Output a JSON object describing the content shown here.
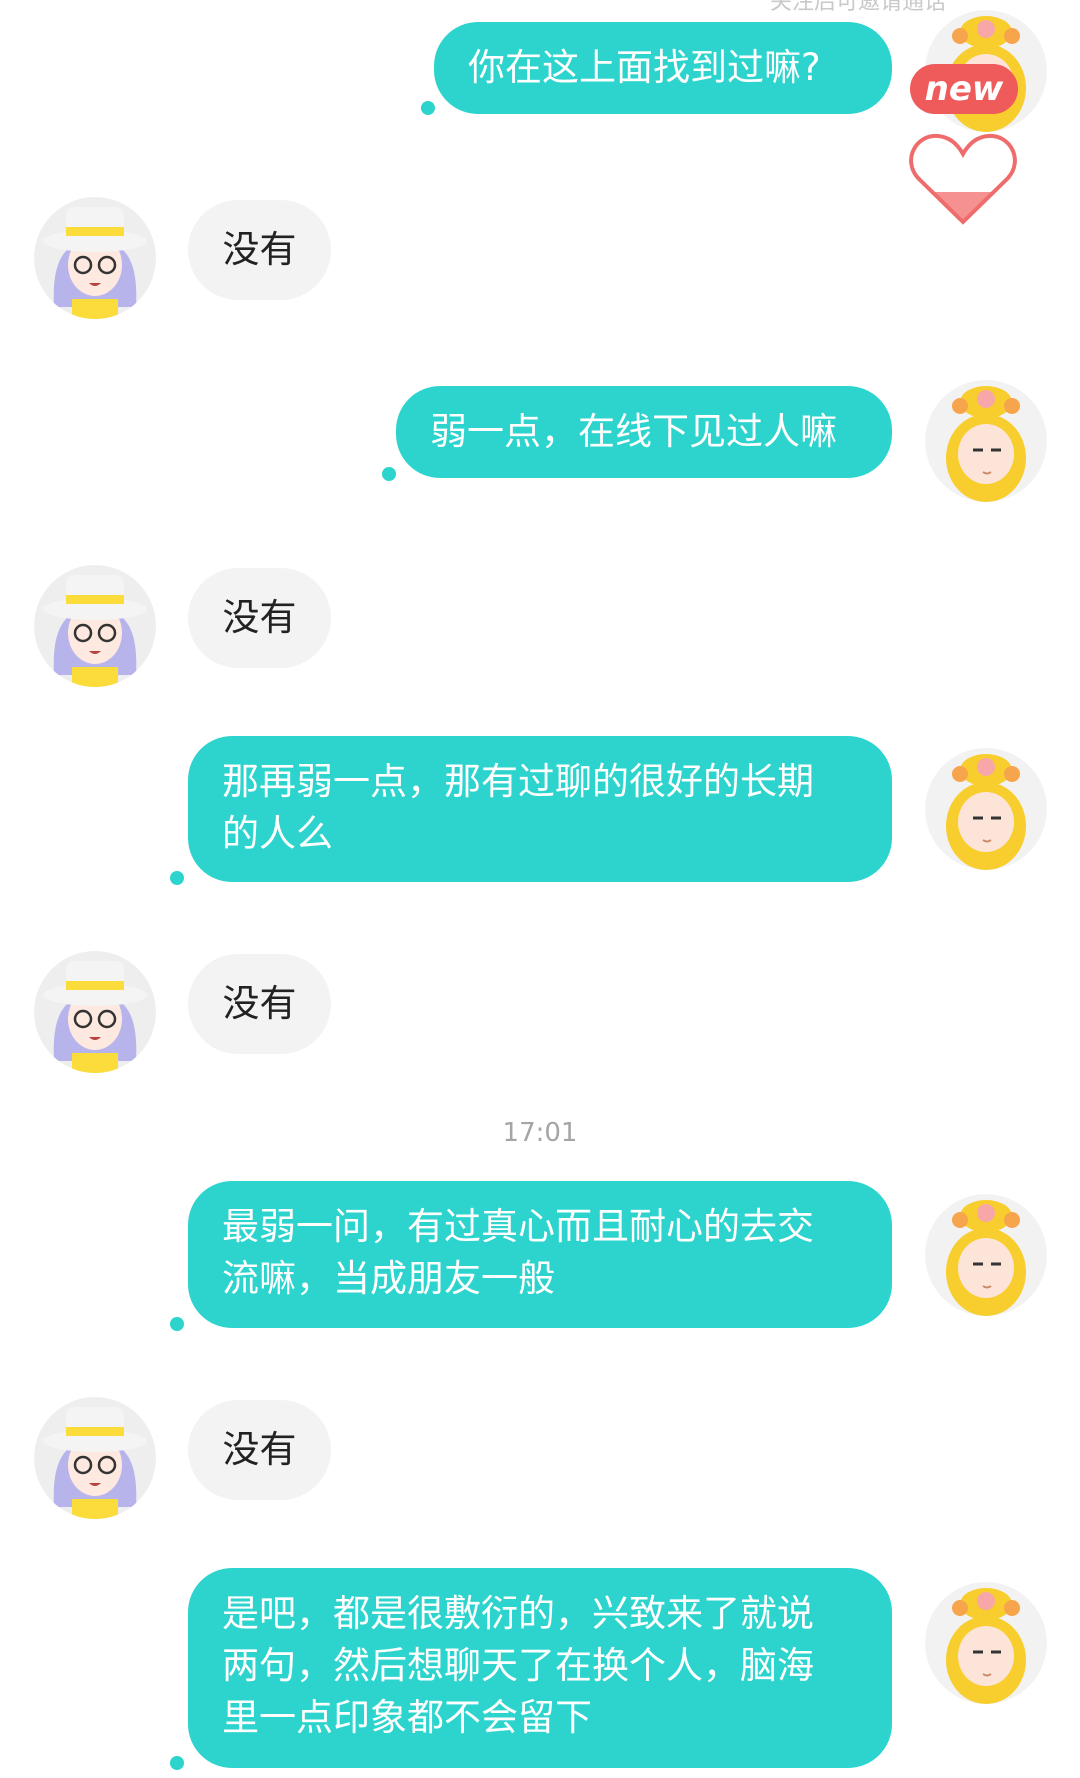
{
  "header": {
    "hint": "关注后可邀请通话"
  },
  "timestamp": "17:01",
  "badge": {
    "label": "new"
  },
  "colors": {
    "outgoing": "#2dd4ce",
    "incoming": "#f3f3f3",
    "badge": "#ef5a5a"
  },
  "messages": [
    {
      "side": "right",
      "text": "你在这上面找到过嘛?"
    },
    {
      "side": "left",
      "text": "没有"
    },
    {
      "side": "right",
      "text": "弱一点，在线下见过人嘛"
    },
    {
      "side": "left",
      "text": "没有"
    },
    {
      "side": "right",
      "lines": [
        "那再弱一点，那有过聊的很好的长期",
        "的人么"
      ]
    },
    {
      "side": "left",
      "text": "没有"
    },
    {
      "side": "right",
      "lines": [
        "最弱一问，有过真心而且耐心的去交",
        "流嘛，当成朋友一般"
      ]
    },
    {
      "side": "left",
      "text": "没有"
    },
    {
      "side": "right",
      "lines": [
        "是吧，都是很敷衍的，兴致来了就说",
        "两句，然后想聊天了在换个人，脑海",
        "里一点印象都不会留下"
      ]
    }
  ]
}
